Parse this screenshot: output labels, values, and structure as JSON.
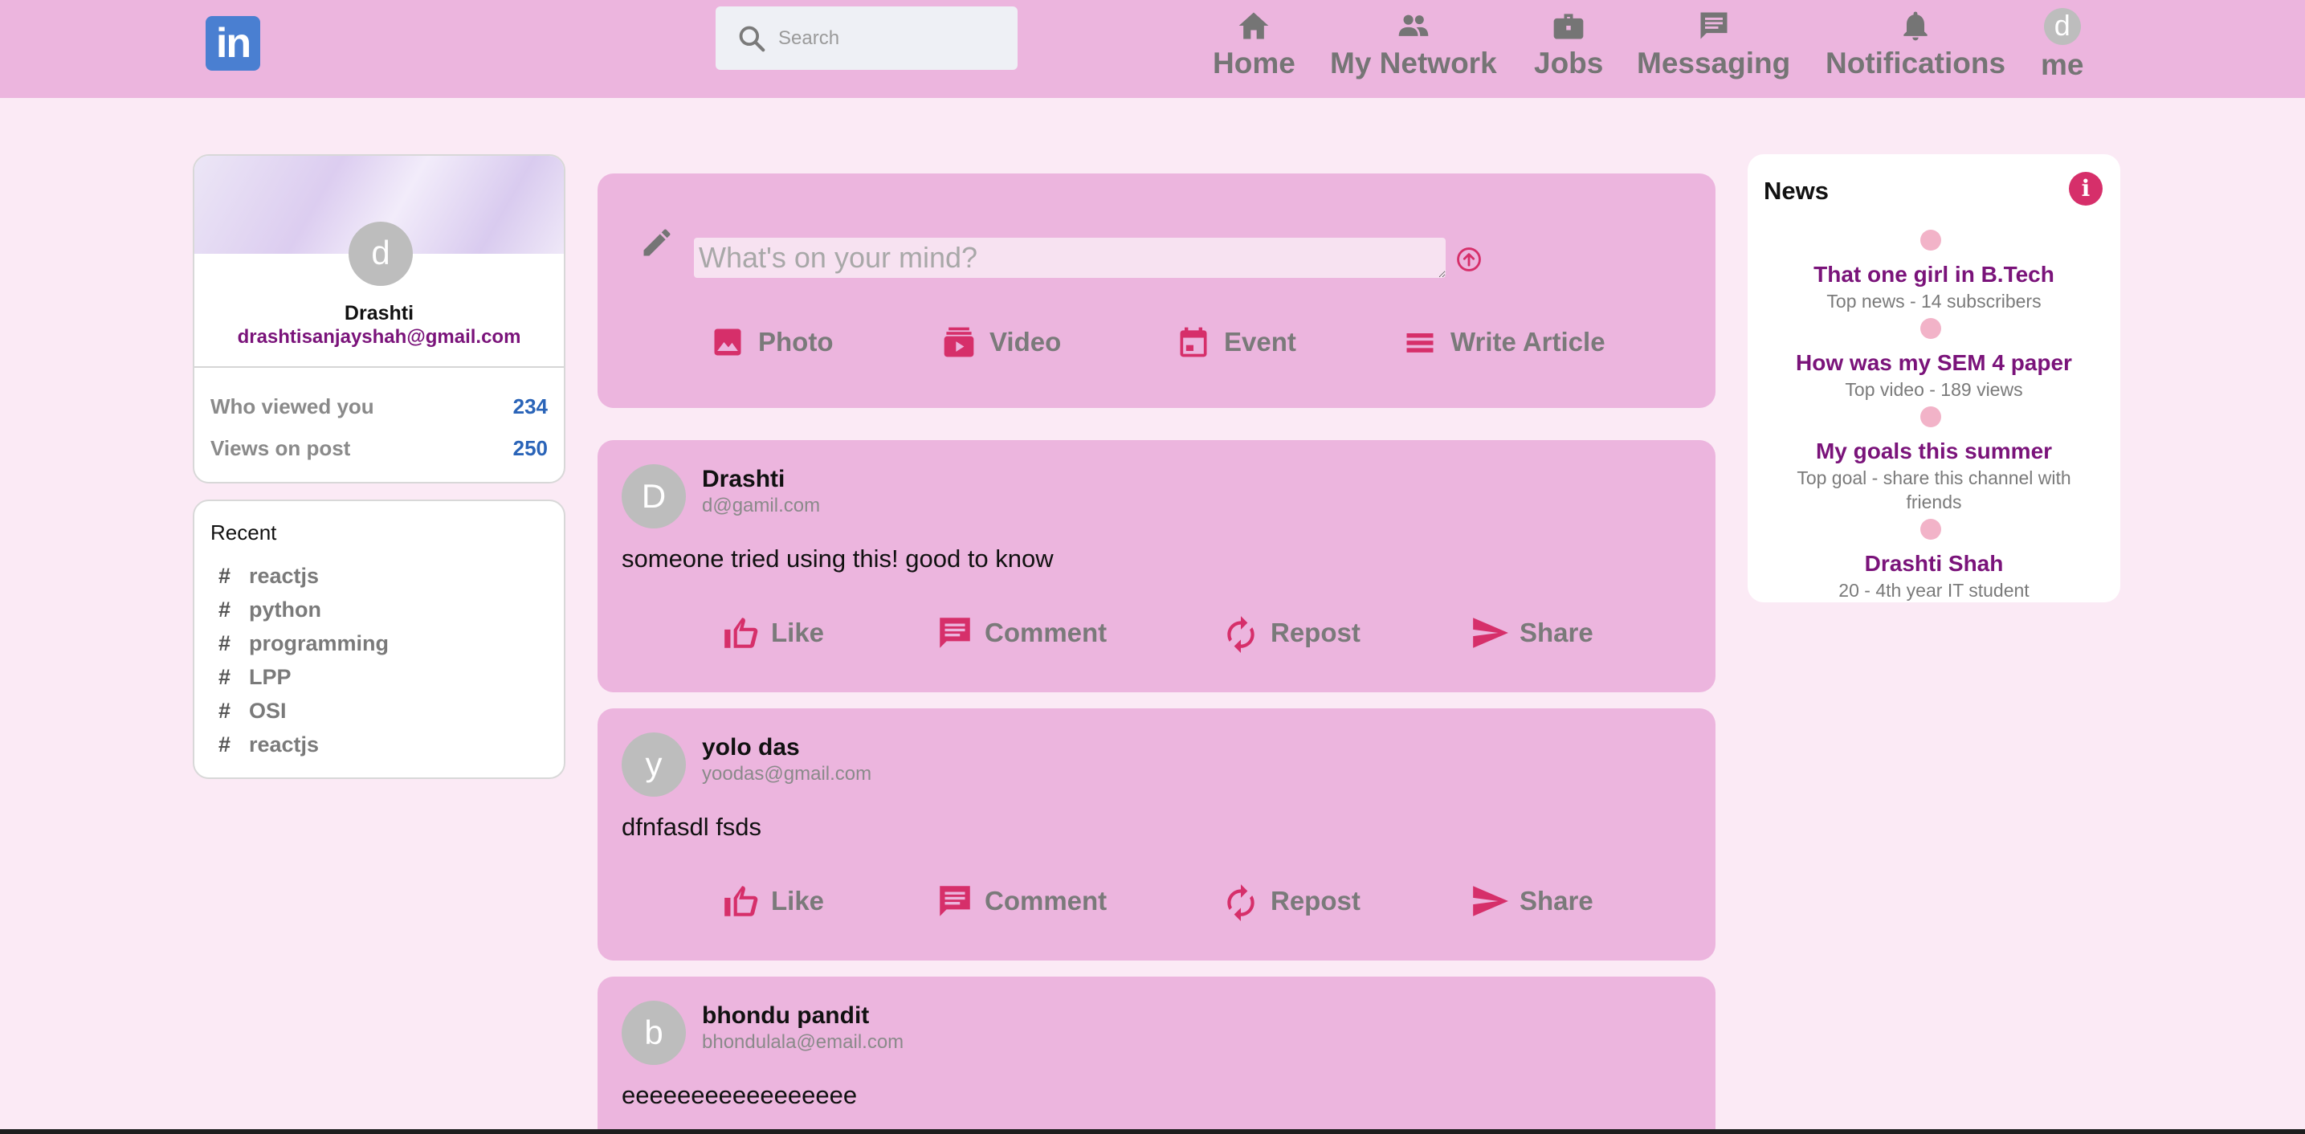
{
  "header": {
    "logo_text": "in",
    "search": {
      "placeholder": "Search",
      "value": ""
    },
    "nav": [
      {
        "label": "Home",
        "icon": "home-icon"
      },
      {
        "label": "My Network",
        "icon": "people-icon"
      },
      {
        "label": "Jobs",
        "icon": "briefcase-icon"
      },
      {
        "label": "Messaging",
        "icon": "chat-icon"
      },
      {
        "label": "Notifications",
        "icon": "bell-icon"
      },
      {
        "label": "me",
        "avatar_letter": "d"
      }
    ]
  },
  "profile": {
    "avatar_letter": "d",
    "name": "Drashti",
    "email": "drashtisanjayshah@gmail.com",
    "stats": [
      {
        "label": "Who viewed you",
        "value": "234"
      },
      {
        "label": "Views on post",
        "value": "250"
      }
    ]
  },
  "recent": {
    "title": "Recent",
    "hash_symbol": "#",
    "items": [
      "reactjs",
      "python",
      "programming",
      "LPP",
      "OSI",
      "reactjs"
    ]
  },
  "composer": {
    "placeholder": "What's on your mind?",
    "actions": [
      {
        "label": "Photo",
        "icon": "image-icon"
      },
      {
        "label": "Video",
        "icon": "video-icon"
      },
      {
        "label": "Event",
        "icon": "calendar-icon"
      },
      {
        "label": "Write Article",
        "icon": "article-icon"
      }
    ]
  },
  "posts": [
    {
      "avatar_letter": "D",
      "author": "Drashti",
      "email": "d@gamil.com",
      "body": "someone tried using this! good to know"
    },
    {
      "avatar_letter": "y",
      "author": "yolo das",
      "email": "yoodas@gmail.com",
      "body": "dfnfasdl fsds"
    },
    {
      "avatar_letter": "b",
      "author": "bhondu pandit",
      "email": "bhondulala@email.com",
      "body": "eeeeeeeeeeeeeeeee"
    }
  ],
  "post_actions": {
    "like": "Like",
    "comment": "Comment",
    "repost": "Repost",
    "share": "Share"
  },
  "news": {
    "title": "News",
    "info_glyph": "i",
    "items": [
      {
        "headline": "That one girl in B.Tech",
        "sub": "Top news - 14 subscribers"
      },
      {
        "headline": "How was my SEM 4 paper",
        "sub": "Top video - 189 views"
      },
      {
        "headline": "My goals this summer",
        "sub": "Top goal - share this channel with friends"
      },
      {
        "headline": "Drashti Shah",
        "sub": "20 - 4th year IT student"
      }
    ]
  },
  "colors": {
    "header_bg": "#ecb5de",
    "page_bg": "#fbeaf5",
    "accent_red": "#d62f6a",
    "link_purple": "#7a137a",
    "stat_blue": "#2a64b8"
  }
}
